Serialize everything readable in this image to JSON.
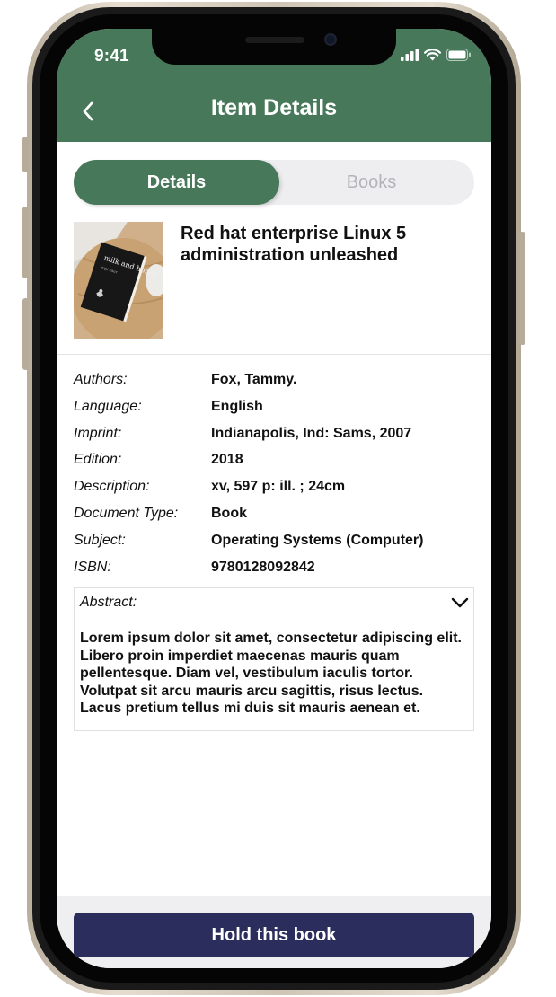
{
  "status_bar": {
    "time": "9:41",
    "icons": [
      "cellular-signal-icon",
      "wifi-icon",
      "battery-icon"
    ]
  },
  "header": {
    "title": "Item Details",
    "back_icon": "chevron-left-icon",
    "background_color": "#47785a"
  },
  "tabs": [
    {
      "label": "Details",
      "active": true
    },
    {
      "label": "Books",
      "active": false
    }
  ],
  "item": {
    "title": "Red hat enterprise Linux 5 administration unleashed",
    "cover": {
      "title": "milk and honey",
      "author": "rupi kaur"
    }
  },
  "details": [
    {
      "label": "Authors:",
      "value": "Fox, Tammy."
    },
    {
      "label": "Language:",
      "value": "English"
    },
    {
      "label": "Imprint:",
      "value": "Indianapolis, Ind: Sams, 2007"
    },
    {
      "label": "Edition:",
      "value": "2018"
    },
    {
      "label": "Description:",
      "value": "xv, 597 p: ill. ; 24cm"
    },
    {
      "label": "Document Type:",
      "value": "Book"
    },
    {
      "label": "Subject:",
      "value": "Operating Systems (Computer)"
    },
    {
      "label": "ISBN:",
      "value": "9780128092842"
    }
  ],
  "abstract": {
    "label": "Abstract:",
    "expand_icon": "chevron-down-icon",
    "text": "Lorem ipsum dolor sit amet, consectetur adipiscing elit. Libero proin imperdiet maecenas mauris quam pellentesque. Diam vel, vestibulum iaculis tortor. Volutpat sit arcu mauris arcu sagittis, risus lectus. Lacus pretium tellus mi duis sit mauris aenean et."
  },
  "actions": {
    "hold_label": "Hold this book",
    "hold_color": "#2b2d5d"
  }
}
